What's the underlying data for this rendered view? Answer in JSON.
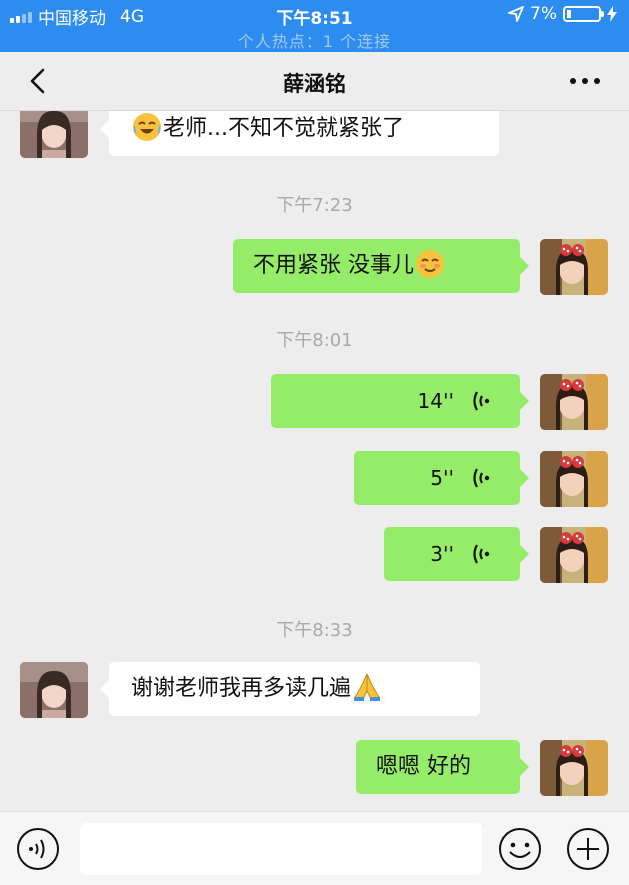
{
  "status_bar": {
    "carrier": "中国移动",
    "network": "4G",
    "time": "下午8:51",
    "battery": "7%",
    "hotspot": "个人热点：1 个连接"
  },
  "nav": {
    "title": "薛涵铭"
  },
  "messages": [
    {
      "side": "left",
      "type": "text",
      "text": "老师...不知不觉就紧张了",
      "emoji_before": "crying-laughing-emoji"
    },
    {
      "type": "time",
      "text": "下午7:23"
    },
    {
      "side": "right",
      "type": "text",
      "text": "不用紧张 没事儿",
      "emoji_after": "blushing-smile-emoji"
    },
    {
      "type": "time",
      "text": "下午8:01"
    },
    {
      "side": "right",
      "type": "voice",
      "duration": "14''"
    },
    {
      "side": "right",
      "type": "voice",
      "duration": "5''"
    },
    {
      "side": "right",
      "type": "voice",
      "duration": "3''"
    },
    {
      "type": "time",
      "text": "下午8:33"
    },
    {
      "side": "left",
      "type": "text",
      "text": "谢谢老师我再多读几遍",
      "emoji_after": "praying-hands-emoji"
    },
    {
      "side": "right",
      "type": "text",
      "text": "嗯嗯 好的"
    }
  ],
  "input_bar": {
    "value": "",
    "placeholder": ""
  },
  "colors": {
    "status_bar_bg": "#2d8cf0",
    "chat_bg": "#ededed",
    "bubble_self": "#95ec69",
    "bubble_other": "#ffffff"
  }
}
